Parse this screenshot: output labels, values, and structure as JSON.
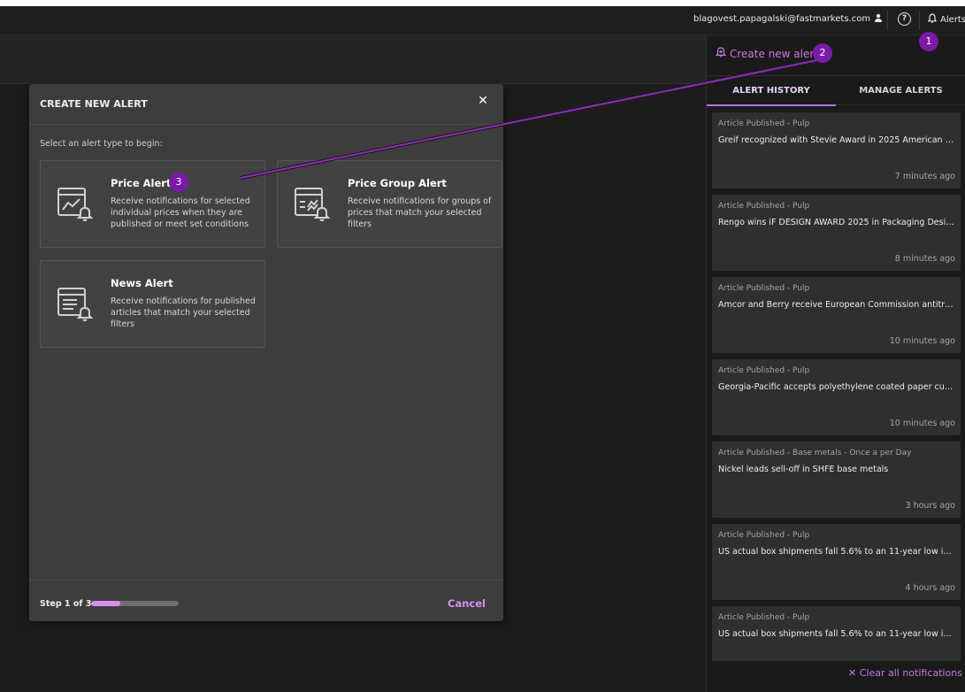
{
  "header": {
    "user_email": "blagovest.papagalski@fastmarkets.com",
    "alerts_label": "Alerts"
  },
  "panel": {
    "create_label": "Create new alert",
    "tabs": [
      {
        "label": "ALERT HISTORY",
        "active": true
      },
      {
        "label": "MANAGE ALERTS",
        "active": false
      }
    ],
    "notifications": [
      {
        "category": "Article Published - Pulp",
        "title": "Greif recognized with Stevie Award in 2025 American B...",
        "time": "7 minutes ago"
      },
      {
        "category": "Article Published - Pulp",
        "title": "Rengo wins iF DESIGN AWARD 2025 in Packaging Design",
        "time": "8 minutes ago"
      },
      {
        "category": "Article Published - Pulp",
        "title": "Amcor and Berry receive European Commission antitru...",
        "time": "10 minutes ago"
      },
      {
        "category": "Article Published - Pulp",
        "title": "Georgia-Pacific accepts polyethylene coated paper cups...",
        "time": "10 minutes ago"
      },
      {
        "category": "Article Published - Base metals - Once a per Day",
        "title": "Nickel leads sell-off in SHFE base metals",
        "time": "3 hours ago"
      },
      {
        "category": "Article Published - Pulp",
        "title": "US actual box shipments fall 5.6% to an 11-year low in ...",
        "time": "4 hours ago"
      },
      {
        "category": "Article Published - Pulp",
        "title": "US actual box shipments fall 5.6% to an 11-year low in ...",
        "time": ""
      }
    ],
    "clear_label": "Clear all notifications"
  },
  "modal": {
    "title": "CREATE NEW ALERT",
    "prompt": "Select an alert type to begin:",
    "options": [
      {
        "name": "Price Alert",
        "desc": "Receive notifications for selected individual prices when they are published or meet set conditions"
      },
      {
        "name": "Price Group Alert",
        "desc": "Receive notifications for groups of prices that match your selected filters"
      },
      {
        "name": "News Alert",
        "desc": "Receive notifications for published articles that match your selected filters"
      }
    ],
    "step_label": "Step 1 of 3",
    "progress_fraction": 0.33,
    "cancel_label": "Cancel"
  },
  "annotations": [
    "1",
    "2",
    "3"
  ],
  "colors": {
    "accent": "#c47be2",
    "badge": "#7a1aa6",
    "background": "#1d1d1d",
    "modal": "#3d3d3d",
    "card": "#2f2f2f"
  }
}
